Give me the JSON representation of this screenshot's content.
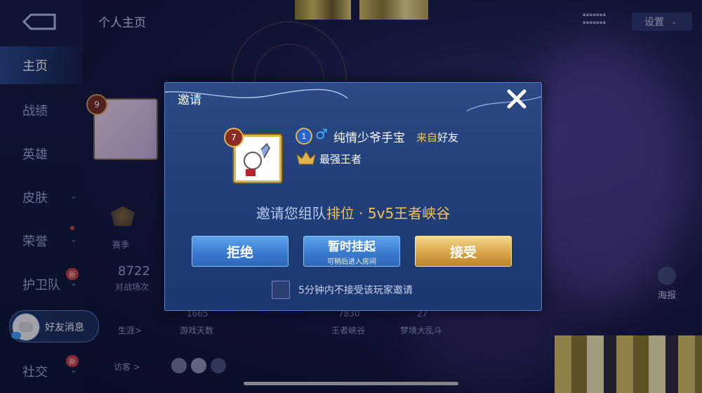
{
  "background": {
    "page_title": "个人主页",
    "settings_label": "设置",
    "settings_caret": "⌄",
    "nav_items": [
      {
        "label": "主页"
      },
      {
        "label": "战绩"
      },
      {
        "label": "英雄"
      },
      {
        "label": "皮肤"
      },
      {
        "label": "荣誉"
      },
      {
        "label": "护卫队"
      },
      {
        "label": "社交"
      }
    ],
    "new_badge": "新",
    "profile_level": "9",
    "stats": {
      "season_label": "赛季",
      "battles_value": "8722",
      "battles_label": "对战场次",
      "days_value": "1665",
      "days_label": "游戏天数",
      "career_label": "生涯>",
      "kings_value": "7830",
      "kings_label": "王者峡谷",
      "brawl_value": "27",
      "brawl_label": "梦境大乱斗",
      "visitors_label": "访客 >"
    },
    "haibao_label": "海报",
    "friend_message_label": "好友消息"
  },
  "dialog": {
    "title": "邀请",
    "inviter": {
      "level": "7",
      "rank_badge": "1",
      "gender_icon": "♂",
      "name": "纯情少爷手宝",
      "from_prefix": "来自",
      "from_source": "好友",
      "rank_name": "最强王者"
    },
    "invite_prefix": "邀请您组队",
    "invite_mode": "排位 · 5v5王者峡谷",
    "buttons": {
      "reject": "拒绝",
      "suspend": "暂时挂起",
      "suspend_sub": "可稍后进入房间",
      "accept": "接受"
    },
    "mute_label": "5分钟内不接受该玩家邀请",
    "mute_checked": false
  },
  "colors": {
    "accent_gold": "#f2c252",
    "button_blue": "#3a7bd0",
    "button_gold": "#d9a54a"
  }
}
